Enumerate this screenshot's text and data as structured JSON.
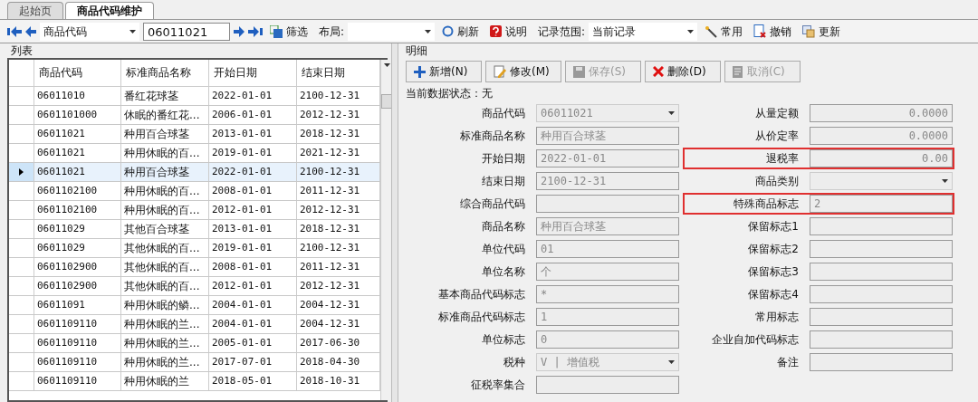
{
  "tabs": [
    {
      "label": "起始页",
      "selected": false
    },
    {
      "label": "商品代码维护",
      "selected": true
    }
  ],
  "toolbar": {
    "search_field": "商品代码",
    "search_value": "06011021",
    "filter": "筛选",
    "layout_label": "布局:",
    "refresh": "刷新",
    "help": "说明",
    "range_label": "记录范围:",
    "range_value": "当前记录",
    "common": "常用",
    "revoke": "撤销",
    "update": "更新"
  },
  "list": {
    "title": "列表",
    "columns": [
      "商品代码",
      "标准商品名称",
      "开始日期",
      "结束日期"
    ],
    "rows": [
      {
        "cells": [
          "06011010",
          "番红花球茎",
          "2022-01-01",
          "2100-12-31"
        ],
        "selected": false
      },
      {
        "cells": [
          "0601101000",
          "休眠的番红花...",
          "2006-01-01",
          "2012-12-31"
        ],
        "selected": false
      },
      {
        "cells": [
          "06011021",
          "种用百合球茎",
          "2013-01-01",
          "2018-12-31"
        ],
        "selected": false
      },
      {
        "cells": [
          "06011021",
          "种用休眠的百...",
          "2019-01-01",
          "2021-12-31"
        ],
        "selected": false
      },
      {
        "cells": [
          "06011021",
          "种用百合球茎",
          "2022-01-01",
          "2100-12-31"
        ],
        "selected": true
      },
      {
        "cells": [
          "0601102100",
          "种用休眠的百...",
          "2008-01-01",
          "2011-12-31"
        ],
        "selected": false
      },
      {
        "cells": [
          "0601102100",
          "种用休眠的百...",
          "2012-01-01",
          "2012-12-31"
        ],
        "selected": false
      },
      {
        "cells": [
          "06011029",
          "其他百合球茎",
          "2013-01-01",
          "2018-12-31"
        ],
        "selected": false
      },
      {
        "cells": [
          "06011029",
          "其他休眠的百...",
          "2019-01-01",
          "2100-12-31"
        ],
        "selected": false
      },
      {
        "cells": [
          "0601102900",
          "其他休眠的百...",
          "2008-01-01",
          "2011-12-31"
        ],
        "selected": false
      },
      {
        "cells": [
          "0601102900",
          "其他休眠的百...",
          "2012-01-01",
          "2012-12-31"
        ],
        "selected": false
      },
      {
        "cells": [
          "06011091",
          "种用休眠的鳞...",
          "2004-01-01",
          "2004-12-31"
        ],
        "selected": false
      },
      {
        "cells": [
          "0601109110",
          "种用休眠的兰...",
          "2004-01-01",
          "2004-12-31"
        ],
        "selected": false
      },
      {
        "cells": [
          "0601109110",
          "种用休眠的兰...",
          "2005-01-01",
          "2017-06-30"
        ],
        "selected": false
      },
      {
        "cells": [
          "0601109110",
          "种用休眠的兰...",
          "2017-07-01",
          "2018-04-30"
        ],
        "selected": false
      },
      {
        "cells": [
          "0601109110",
          "种用休眠的兰",
          "2018-05-01",
          "2018-10-31"
        ],
        "selected": false
      }
    ]
  },
  "detail": {
    "title": "明细",
    "buttons": [
      {
        "label": "新增(N)",
        "kind": "add",
        "disabled": false
      },
      {
        "label": "修改(M)",
        "kind": "edit",
        "disabled": false
      },
      {
        "label": "保存(S)",
        "kind": "save",
        "disabled": true
      },
      {
        "label": "删除(D)",
        "kind": "delete",
        "disabled": false
      },
      {
        "label": "取消(C)",
        "kind": "cancel",
        "disabled": true
      }
    ],
    "status": "当前数据状态：无",
    "left_fields": [
      {
        "label": "商品代码",
        "value": "06011021",
        "kind": "combo",
        "highlighted": false
      },
      {
        "label": "标准商品名称",
        "value": "种用百合球茎",
        "kind": "text",
        "highlighted": false
      },
      {
        "label": "开始日期",
        "value": "2022-01-01",
        "kind": "text",
        "highlighted": false
      },
      {
        "label": "结束日期",
        "value": "2100-12-31",
        "kind": "text",
        "highlighted": false
      },
      {
        "label": "综合商品代码",
        "kind": "text",
        "highlighted": false
      },
      {
        "label": "商品名称",
        "value": "种用百合球茎",
        "kind": "text",
        "highlighted": false
      },
      {
        "label": "单位代码",
        "value": "01",
        "kind": "text",
        "highlighted": false
      },
      {
        "label": "单位名称",
        "value": "个",
        "kind": "text",
        "highlighted": false
      },
      {
        "label": "基本商品代码标志",
        "value": "*",
        "kind": "text",
        "highlighted": false
      },
      {
        "label": "标准商品代码标志",
        "value": "1",
        "kind": "text",
        "highlighted": false
      },
      {
        "label": "单位标志",
        "value": "0",
        "kind": "text",
        "highlighted": false
      },
      {
        "label": "税种",
        "value": "V | 增值税",
        "kind": "combo",
        "highlighted": false
      },
      {
        "label": "征税率集合",
        "kind": "text",
        "highlighted": false
      }
    ],
    "right_fields": [
      {
        "label": "从量定额",
        "value": "0.0000",
        "kind": "number",
        "highlighted": false
      },
      {
        "label": "从价定率",
        "value": "0.0000",
        "kind": "number",
        "highlighted": false
      },
      {
        "label": "退税率",
        "value": "0.00",
        "kind": "number",
        "highlighted": true
      },
      {
        "label": "商品类别",
        "kind": "combo",
        "highlighted": false
      },
      {
        "label": "特殊商品标志",
        "value": "2",
        "kind": "text",
        "highlighted": true
      },
      {
        "label": "保留标志1",
        "kind": "text",
        "highlighted": false
      },
      {
        "label": "保留标志2",
        "kind": "text",
        "highlighted": false
      },
      {
        "label": "保留标志3",
        "kind": "text",
        "highlighted": false
      },
      {
        "label": "保留标志4",
        "kind": "text",
        "highlighted": false
      },
      {
        "label": "常用标志",
        "kind": "text",
        "highlighted": false
      },
      {
        "label": "企业自加代码标志",
        "kind": "text",
        "highlighted": false
      },
      {
        "label": "备注",
        "kind": "text",
        "highlighted": false
      }
    ]
  }
}
